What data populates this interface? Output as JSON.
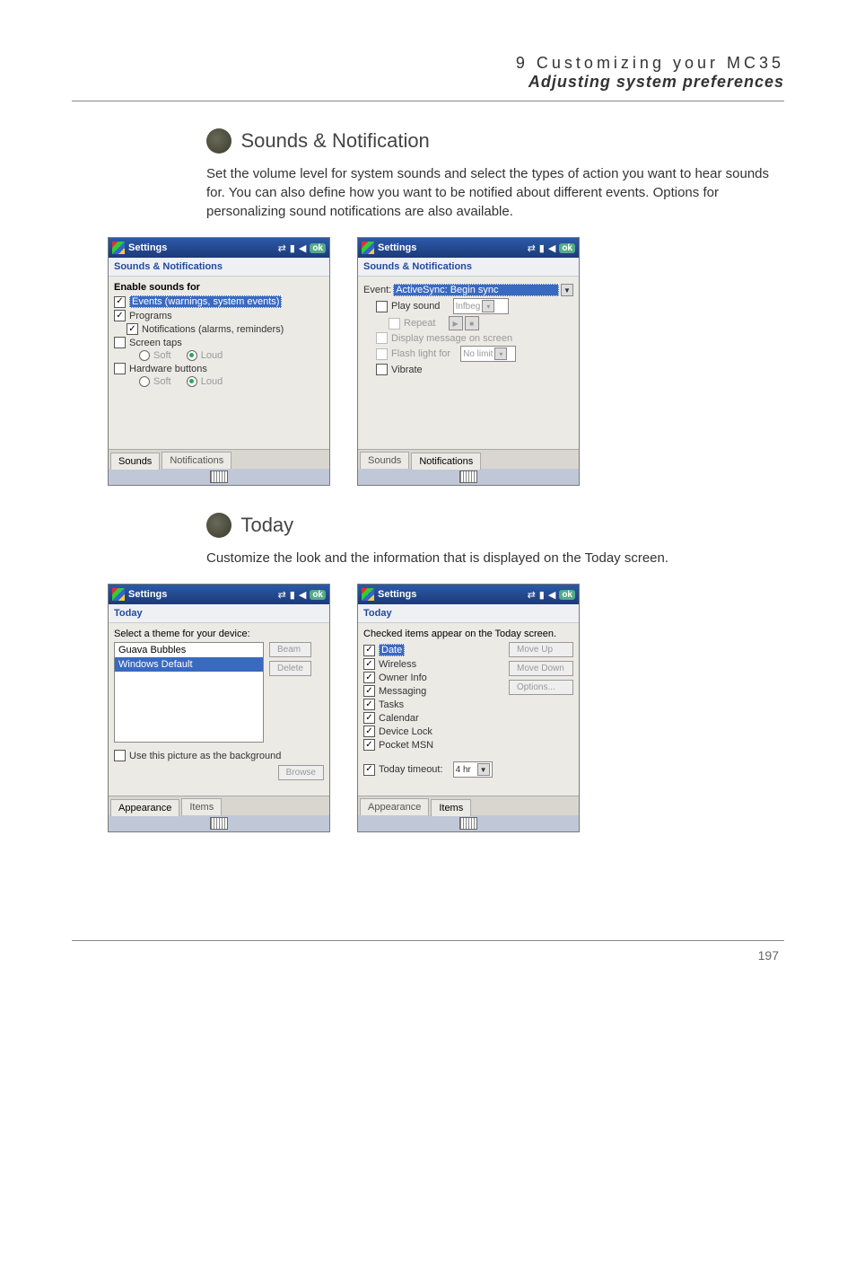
{
  "header": {
    "chapter": "9 Customizing your MC35",
    "section": "Adjusting system preferences"
  },
  "sounds": {
    "title": "Sounds & Notification",
    "body": "Set the volume level for system sounds and select the types of action you want to hear sounds for. You can also define how you want to be notified about different events. Options for personalizing sound notifications are also available."
  },
  "today": {
    "title": "Today",
    "body": "Customize the look and the information that is displayed on the Today screen."
  },
  "shot1": {
    "tb": "Settings",
    "ok": "ok",
    "sub": "Sounds & Notifications",
    "heading": "Enable sounds for",
    "events": "Events (warnings, system events)",
    "programs": "Programs",
    "notif": "Notifications (alarms, reminders)",
    "screentaps": "Screen taps",
    "soft1": "Soft",
    "loud1": "Loud",
    "hw": "Hardware buttons",
    "soft2": "Soft",
    "loud2": "Loud",
    "tab1": "Sounds",
    "tab2": "Notifications"
  },
  "shot2": {
    "tb": "Settings",
    "ok": "ok",
    "sub": "Sounds & Notifications",
    "eventlbl": "Event:",
    "eventval": "ActiveSync: Begin sync",
    "playsound": "Play sound",
    "soundval": "Infbeg",
    "repeat": "Repeat",
    "displaymsg": "Display message on screen",
    "flash": "Flash light for",
    "flashval": "No limit",
    "vibrate": "Vibrate",
    "tab1": "Sounds",
    "tab2": "Notifications"
  },
  "shot3": {
    "tb": "Settings",
    "ok": "ok",
    "sub": "Today",
    "selectlbl": "Select a theme for your device:",
    "theme1": "Guava Bubbles",
    "theme2": "Windows Default",
    "beam": "Beam",
    "delete": "Delete",
    "usepic": "Use this picture as the background",
    "browse": "Browse",
    "tab1": "Appearance",
    "tab2": "Items"
  },
  "shot4": {
    "tb": "Settings",
    "ok": "ok",
    "sub": "Today",
    "checkedlbl": "Checked items appear on the Today screen.",
    "i1": "Date",
    "i2": "Wireless",
    "i3": "Owner Info",
    "i4": "Messaging",
    "i5": "Tasks",
    "i6": "Calendar",
    "i7": "Device Lock",
    "i8": "Pocket MSN",
    "moveup": "Move Up",
    "movedown": "Move Down",
    "options": "Options...",
    "timeout": "Today timeout:",
    "timeoutval": "4 hr",
    "tab1": "Appearance",
    "tab2": "Items"
  },
  "page": "197"
}
